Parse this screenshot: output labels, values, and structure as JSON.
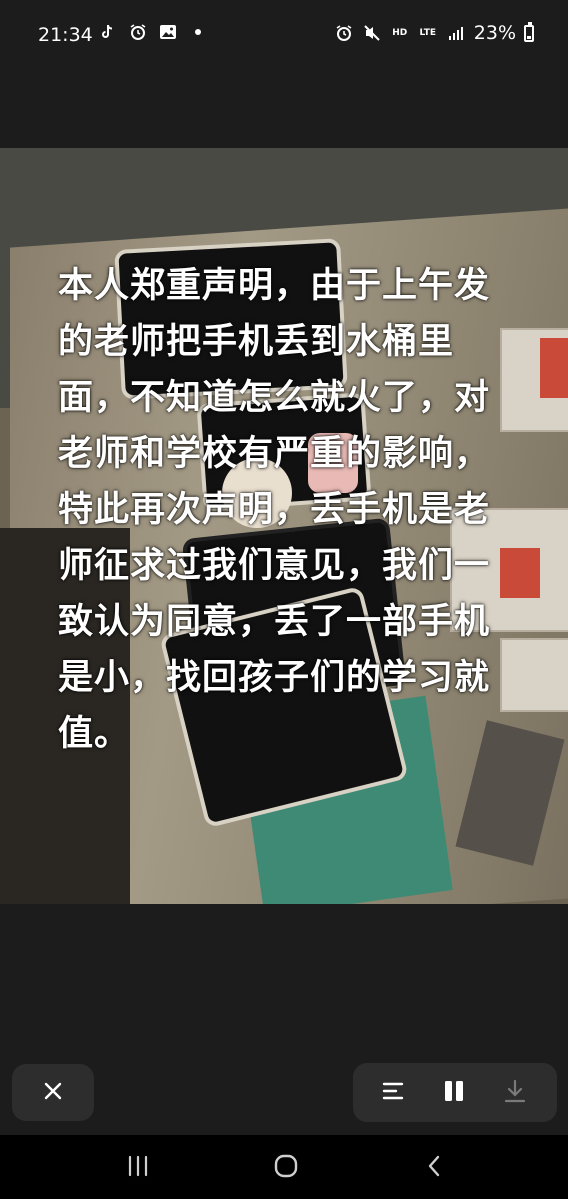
{
  "status_bar": {
    "time": "21:34",
    "left_icons": [
      "tiktok-icon",
      "alarm-icon",
      "gallery-icon",
      "dot-icon"
    ],
    "right_icons": [
      "alarm-icon",
      "mute-icon",
      "hd-icon",
      "lte-icon",
      "signal-icon"
    ],
    "hd_label": "HD",
    "lte_label": "LTE",
    "battery_percent": "23%",
    "battery_level": 0.23
  },
  "media": {
    "overlay_text": "本人郑重声明，由于上午发的老师把手机丢到水桶里面，不知道怎么就火了，对老师和学校有严重的影响，特此再次声明，丢手机是老师征求过我们意见，我们一致认为同意，丢了一部手机是小，找回孩子们的学习就值。"
  },
  "controls": {
    "close_icon": "close-icon",
    "menu_icon": "menu-icon",
    "pause_icon": "pause-icon",
    "download_icon": "download-icon"
  },
  "nav_bar": {
    "recents_icon": "recents-icon",
    "home_icon": "home-icon",
    "back_icon": "back-icon"
  },
  "colors": {
    "background": "#1c1c1c",
    "button_bg": "#2d2d2d",
    "nav_bg": "#000000",
    "text": "#ffffff"
  }
}
